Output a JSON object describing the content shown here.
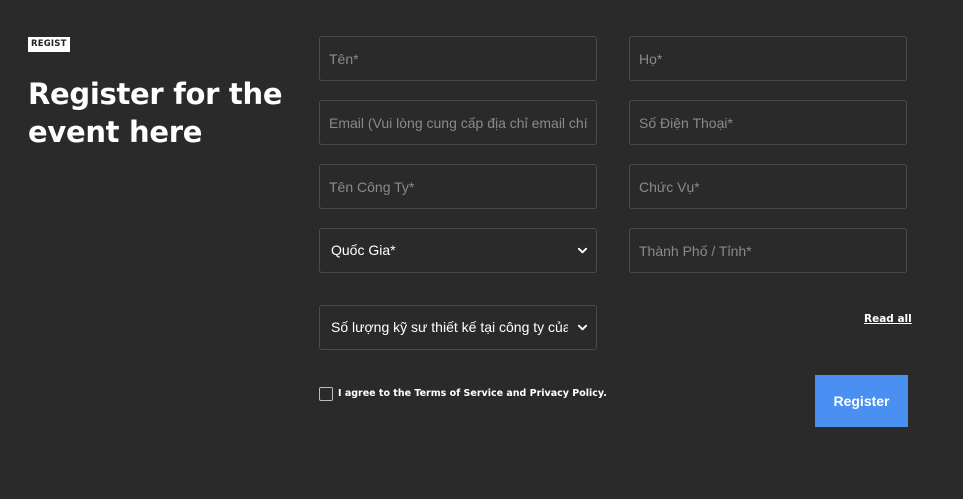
{
  "intro": {
    "badge": "REGIST",
    "headline": "Register for the event here"
  },
  "form": {
    "first_name_placeholder": "Tên*",
    "last_name_placeholder": "Họ*",
    "email_placeholder": "Email (Vui lòng cung cấp địa chỉ email chính xác)*",
    "phone_placeholder": "Số Điện Thoại*",
    "company_placeholder": "Tên Công Ty*",
    "job_title_placeholder": "Chức Vụ*",
    "country_selected": "Quốc Gia*",
    "city_placeholder": "Thành Phố / Tỉnh*",
    "engineers_selected": "Số lượng kỹ sư thiết kế tại công ty của bạn*"
  },
  "terms": {
    "read_all_label": "Read all",
    "agree_text": "I agree to the Terms of Service and Privacy Policy.",
    "checked": false
  },
  "actions": {
    "register_label": "Register"
  },
  "colors": {
    "background": "#2a2a2a",
    "field_border": "#4a4a4a",
    "accent_button": "#4a8ff2"
  }
}
